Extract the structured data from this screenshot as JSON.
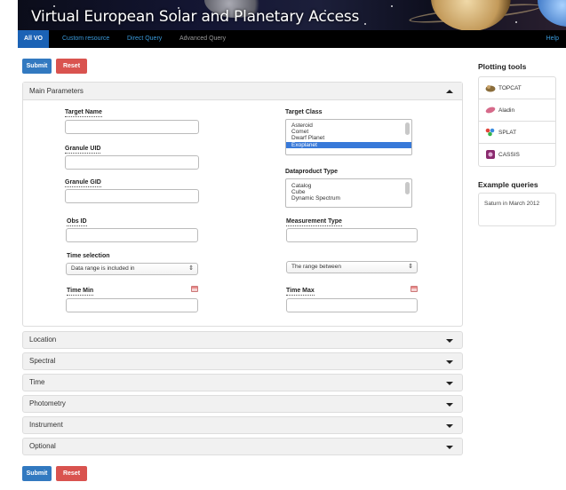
{
  "banner": {
    "title": "Virtual European Solar and Planetary Access"
  },
  "nav": {
    "tabs": [
      {
        "label": "All VO"
      },
      {
        "label": "Custom resource"
      },
      {
        "label": "Direct Query"
      },
      {
        "label": "Advanced Query"
      }
    ],
    "help": "Help"
  },
  "actions": {
    "submit": "Submit",
    "reset": "Reset"
  },
  "main_panel": {
    "title": "Main Parameters",
    "fields": {
      "target_name": "Target Name",
      "granule_uid": "Granule UID",
      "granule_gid": "Granule GID",
      "obs_id": "Obs ID",
      "time_selection": "Time selection",
      "time_min": "Time Min",
      "target_class": "Target Class",
      "dataproduct_type": "Dataproduct Type",
      "measurement_type": "Measurement Type",
      "time_max": "Time Max"
    },
    "target_class_options": [
      "Asteroid",
      "Comet",
      "Dwarf Planet",
      "Exoplanet"
    ],
    "target_class_selected": "Exoplanet",
    "dataproduct_options": [
      "Catalog",
      "Cube",
      "Dynamic Spectrum"
    ],
    "time_selection_value": "Data range is included in",
    "time_range_value": "The range between"
  },
  "sections": [
    "Location",
    "Spectral",
    "Time",
    "Photometry",
    "Instrument",
    "Optional"
  ],
  "sidebar": {
    "plotting_title": "Plotting tools",
    "tools": [
      {
        "label": "TOPCAT",
        "icon": "topcat-icon"
      },
      {
        "label": "Aladin",
        "icon": "aladin-icon"
      },
      {
        "label": "SPLAT",
        "icon": "splat-icon"
      },
      {
        "label": "CASSIS",
        "icon": "cassis-icon"
      }
    ],
    "examples_title": "Example queries",
    "examples": [
      "Saturn in March 2012"
    ]
  },
  "colors": {
    "nav_active": "#1b62b5",
    "submit": "#3279c0",
    "reset": "#d9534f",
    "link": "#3a9bdc"
  }
}
